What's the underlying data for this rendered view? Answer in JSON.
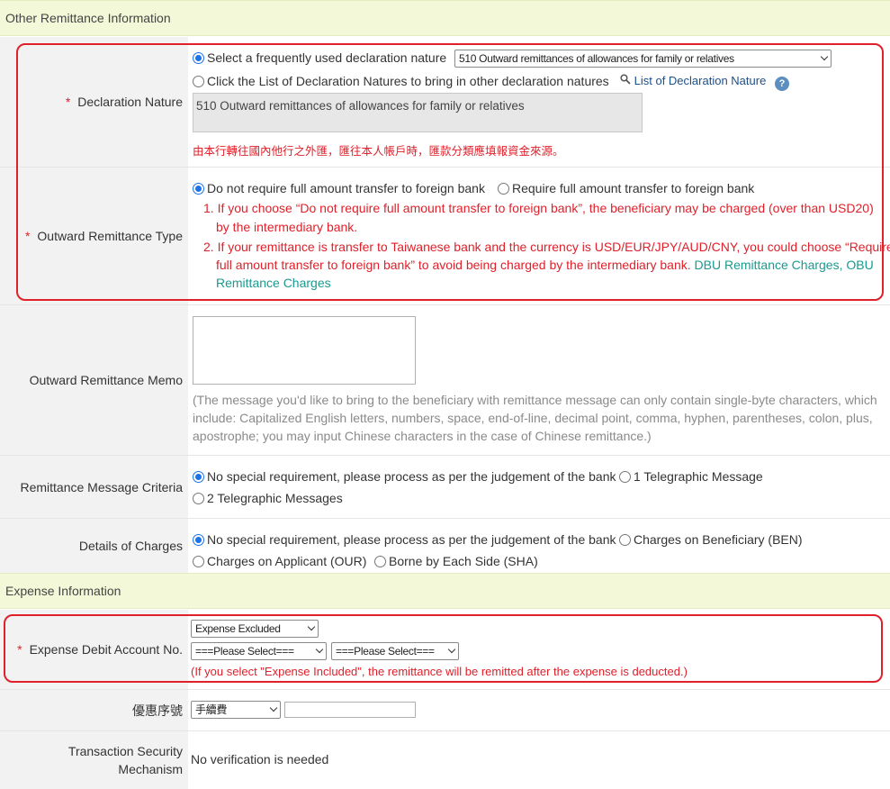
{
  "sections": {
    "other_info": "Other Remittance Information",
    "expense_info": "Expense Information"
  },
  "declaration": {
    "label": "Declaration Nature",
    "opt_frequent": "Select a frequently used declaration nature",
    "frequent_select": "510 Outward remittances of allowances for family or relatives",
    "opt_list": "Click the List of Declaration Natures to bring in other declaration natures",
    "list_link": "List of Declaration Nature",
    "selected_text": "510 Outward remittances of allowances for family or relatives",
    "note_zh": "由本行轉往國內他行之外匯，匯往本人帳戶時，匯款分類應填報資金來源。"
  },
  "remit_type": {
    "label": "Outward Remittance Type",
    "opt_no_full": "Do not require full amount transfer to foreign bank",
    "opt_full": "Require full amount transfer to foreign bank",
    "note1_a": "1. If you choose “Do not require full amount transfer to foreign bank”, the beneficiary may be charged (over than USD20)",
    "note1_b": "by the intermediary bank.",
    "note2_a": "2. If your remittance is transfer to Taiwanese bank and the currency is USD/EUR/JPY/AUD/CNY, you could choose “Require",
    "note2_b": "full amount transfer to foreign bank”  to avoid being charged by the intermediary bank.",
    "link_dbu": "DBU Remittance Charges",
    "comma": ",",
    "link_obu_a": "OBU",
    "link_obu_b": "Remittance Charges"
  },
  "memo": {
    "label": "Outward Remittance Memo",
    "value": "",
    "help_1": "(The message you'd like to bring to the beneficiary with remittance message can only contain single-byte characters, which",
    "help_2": "include: Capitalized English letters, numbers, space, end-of-line, decimal point, comma, hyphen, parentheses, colon, plus,",
    "help_3": "apostrophe; you may input Chinese characters in the case of Chinese remittance.)"
  },
  "msg_criteria": {
    "label": "Remittance Message Criteria",
    "opt_none": "No special requirement, please process as per the judgement of the bank",
    "opt_1": "1 Telegraphic Message",
    "opt_2": "2 Telegraphic Messages"
  },
  "charges": {
    "label": "Details of Charges",
    "opt_none": "No special requirement, please process as per the judgement of the bank",
    "opt_ben": "Charges on Beneficiary (BEN)",
    "opt_our": "Charges on Applicant (OUR)",
    "opt_sha": "Borne by Each Side (SHA)"
  },
  "expense": {
    "label": "Expense Debit Account No.",
    "select_type": "Expense Excluded",
    "select_a": "===Please Select===",
    "select_b": "===Please Select===",
    "note": "(If you select \"Expense Included\", the remittance will be remitted after the expense is deducted.)"
  },
  "discount": {
    "label": "優惠序號",
    "select": "手續費",
    "value": ""
  },
  "security": {
    "label_1": "Transaction Security",
    "label_2": "Mechanism",
    "value": "No verification is needed"
  },
  "colors": {
    "section_bg": "#f3f9d8",
    "label_bg": "#f2f2f2",
    "accent_red": "#e0202a",
    "link_teal": "#1a9a8f",
    "radio_blue": "#1a73e8"
  },
  "icons": [
    "search-icon",
    "help-icon",
    "chevron-down-icon"
  ]
}
